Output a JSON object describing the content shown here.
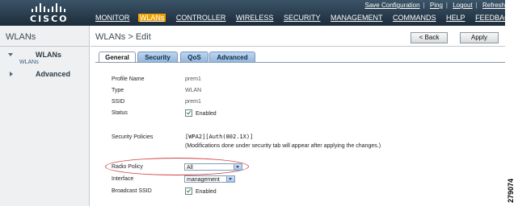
{
  "header": {
    "logo_text": "CISCO",
    "utility_links": [
      "Save Configuration",
      "Ping",
      "Logout",
      "Refresh"
    ],
    "menu": [
      "MONITOR",
      "WLANs",
      "CONTROLLER",
      "WIRELESS",
      "SECURITY",
      "MANAGEMENT",
      "COMMANDS",
      "HELP",
      "FEEDBACK"
    ],
    "active_menu": "WLANs"
  },
  "sidebar": {
    "title": "WLANs",
    "items": [
      {
        "label": "WLANs",
        "sub": "WLANs",
        "expanded": true
      },
      {
        "label": "Advanced",
        "expanded": false
      }
    ]
  },
  "main": {
    "title": "WLANs > Edit",
    "back_label": "< Back",
    "apply_label": "Apply",
    "tabs": [
      "General",
      "Security",
      "QoS",
      "Advanced"
    ],
    "active_tab": "General"
  },
  "form": {
    "profile_name_label": "Profile Name",
    "profile_name_value": "prem1",
    "type_label": "Type",
    "type_value": "WLAN",
    "ssid_label": "SSID",
    "ssid_value": "prem1",
    "status_label": "Status",
    "status_value": "Enabled",
    "status_checked": true,
    "security_policies_label": "Security Policies",
    "security_policies_value": "[WPA2][Auth(802.1X)]",
    "security_note": "(Modifications done under security tab will appear after applying the changes.)",
    "radio_policy_label": "Radio Policy",
    "radio_policy_value": "All",
    "interface_label": "Interface",
    "interface_value": "management",
    "broadcast_ssid_label": "Broadcast SSID",
    "broadcast_ssid_value": "Enabled",
    "broadcast_ssid_checked": true
  },
  "figure_number": "279074",
  "colors": {
    "header_bg": "#1c2c3a",
    "active_menu": "#f0a000",
    "highlight": "#d34040"
  }
}
